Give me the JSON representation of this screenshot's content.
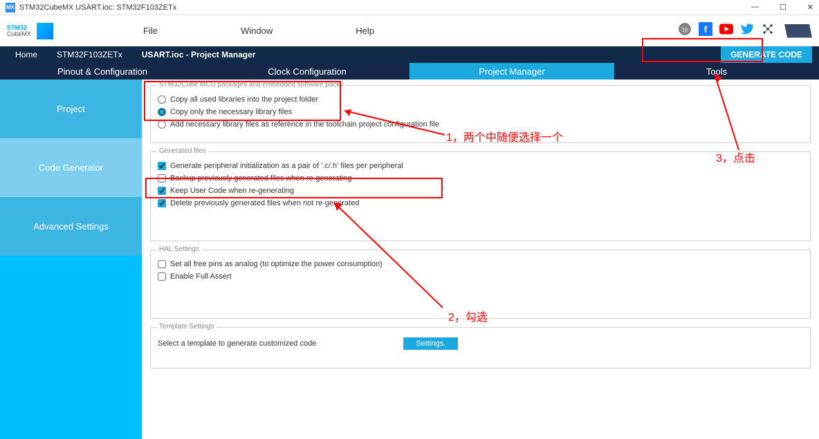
{
  "window": {
    "title": "STM32CubeMX USART.ioc: STM32F103ZETx"
  },
  "logo": {
    "line1": "STM32",
    "line2": "CubeMX"
  },
  "menu": {
    "file": "File",
    "window": "Window",
    "help": "Help"
  },
  "breadcrumb": {
    "home": "Home",
    "chip": "STM32F103ZETx",
    "current": "USART.ioc - Project Manager"
  },
  "generate": "GENERATE CODE",
  "tabs": {
    "pinout": "Pinout & Configuration",
    "clock": "Clock Configuration",
    "pm": "Project Manager",
    "tools": "Tools"
  },
  "sidebar": {
    "project": "Project",
    "codegen": "Code Generator",
    "advanced": "Advanced Settings"
  },
  "section1": {
    "legend": "STM32Cube MCU packages and embedded software packs",
    "opt1": "Copy all used libraries into the project folder",
    "opt2": "Copy only the necessary library files",
    "opt3": "Add necessary library files as reference in the toolchain project configuration file"
  },
  "section2": {
    "legend": "Generated files",
    "opt1": "Generate peripheral initialization as a pair of '.c/.h' files per peripheral",
    "opt2": "Backup previously generated files when re-generating",
    "opt3": "Keep User Code when re-generating",
    "opt4": "Delete previously generated files when not re-generated"
  },
  "section3": {
    "legend": "HAL Settings",
    "opt1": "Set all free pins as analog (to optimize the power consumption)",
    "opt2": "Enable Full Assert"
  },
  "section4": {
    "legend": "Template Settings",
    "text": "Select a template to generate customized code",
    "btn": "Settings."
  },
  "annot": {
    "a1": "1，两个中随便选择一个",
    "a2": "2，勾选",
    "a3": "3，点击"
  }
}
